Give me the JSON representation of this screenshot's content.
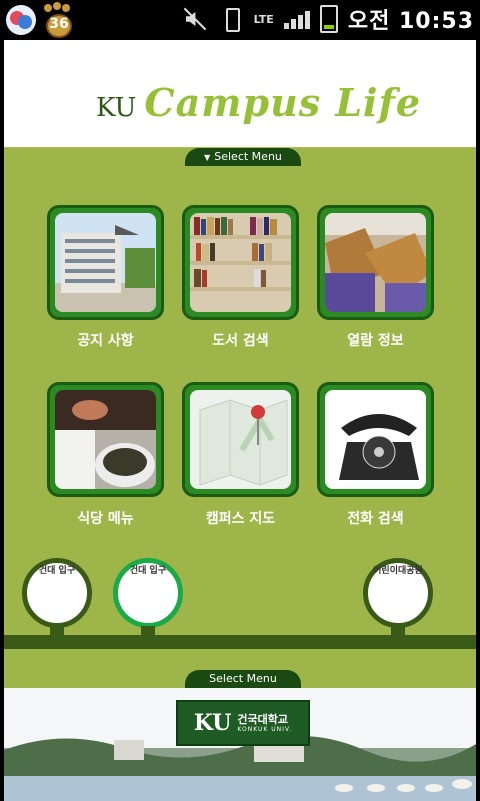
{
  "status_bar": {
    "notification_count": "36",
    "network": "LTE",
    "time": "오전 10:53"
  },
  "header": {
    "brand_prefix": "KU",
    "brand_title": "Campus Life"
  },
  "select_menu_top": {
    "label": "Select Menu"
  },
  "menu": {
    "items": [
      {
        "label": "공지 사항",
        "icon": "building-photo-icon"
      },
      {
        "label": "도서 검색",
        "icon": "bookshelf-photo-icon"
      },
      {
        "label": "열람 정보",
        "icon": "reading-room-photo-icon"
      },
      {
        "label": "식당 메뉴",
        "icon": "food-photo-icon"
      },
      {
        "label": "캠퍼스 지도",
        "icon": "map-pin-icon"
      },
      {
        "label": "전화 검색",
        "icon": "telephone-icon"
      }
    ]
  },
  "bus_stops": [
    {
      "label": "건대 입구"
    },
    {
      "label": "건대 입구"
    },
    {
      "label": "어린이대공원"
    }
  ],
  "select_menu_bottom": {
    "label": "Select Menu"
  },
  "footer": {
    "logo_ku": "KU",
    "logo_kr": "건국대학교",
    "logo_en": "KONKUK UNIV."
  },
  "colors": {
    "menu_bg": "#9eb54a",
    "tile_border": "#1a5a12",
    "road": "#3a5a18",
    "active_stop": "#1aaa4a"
  }
}
